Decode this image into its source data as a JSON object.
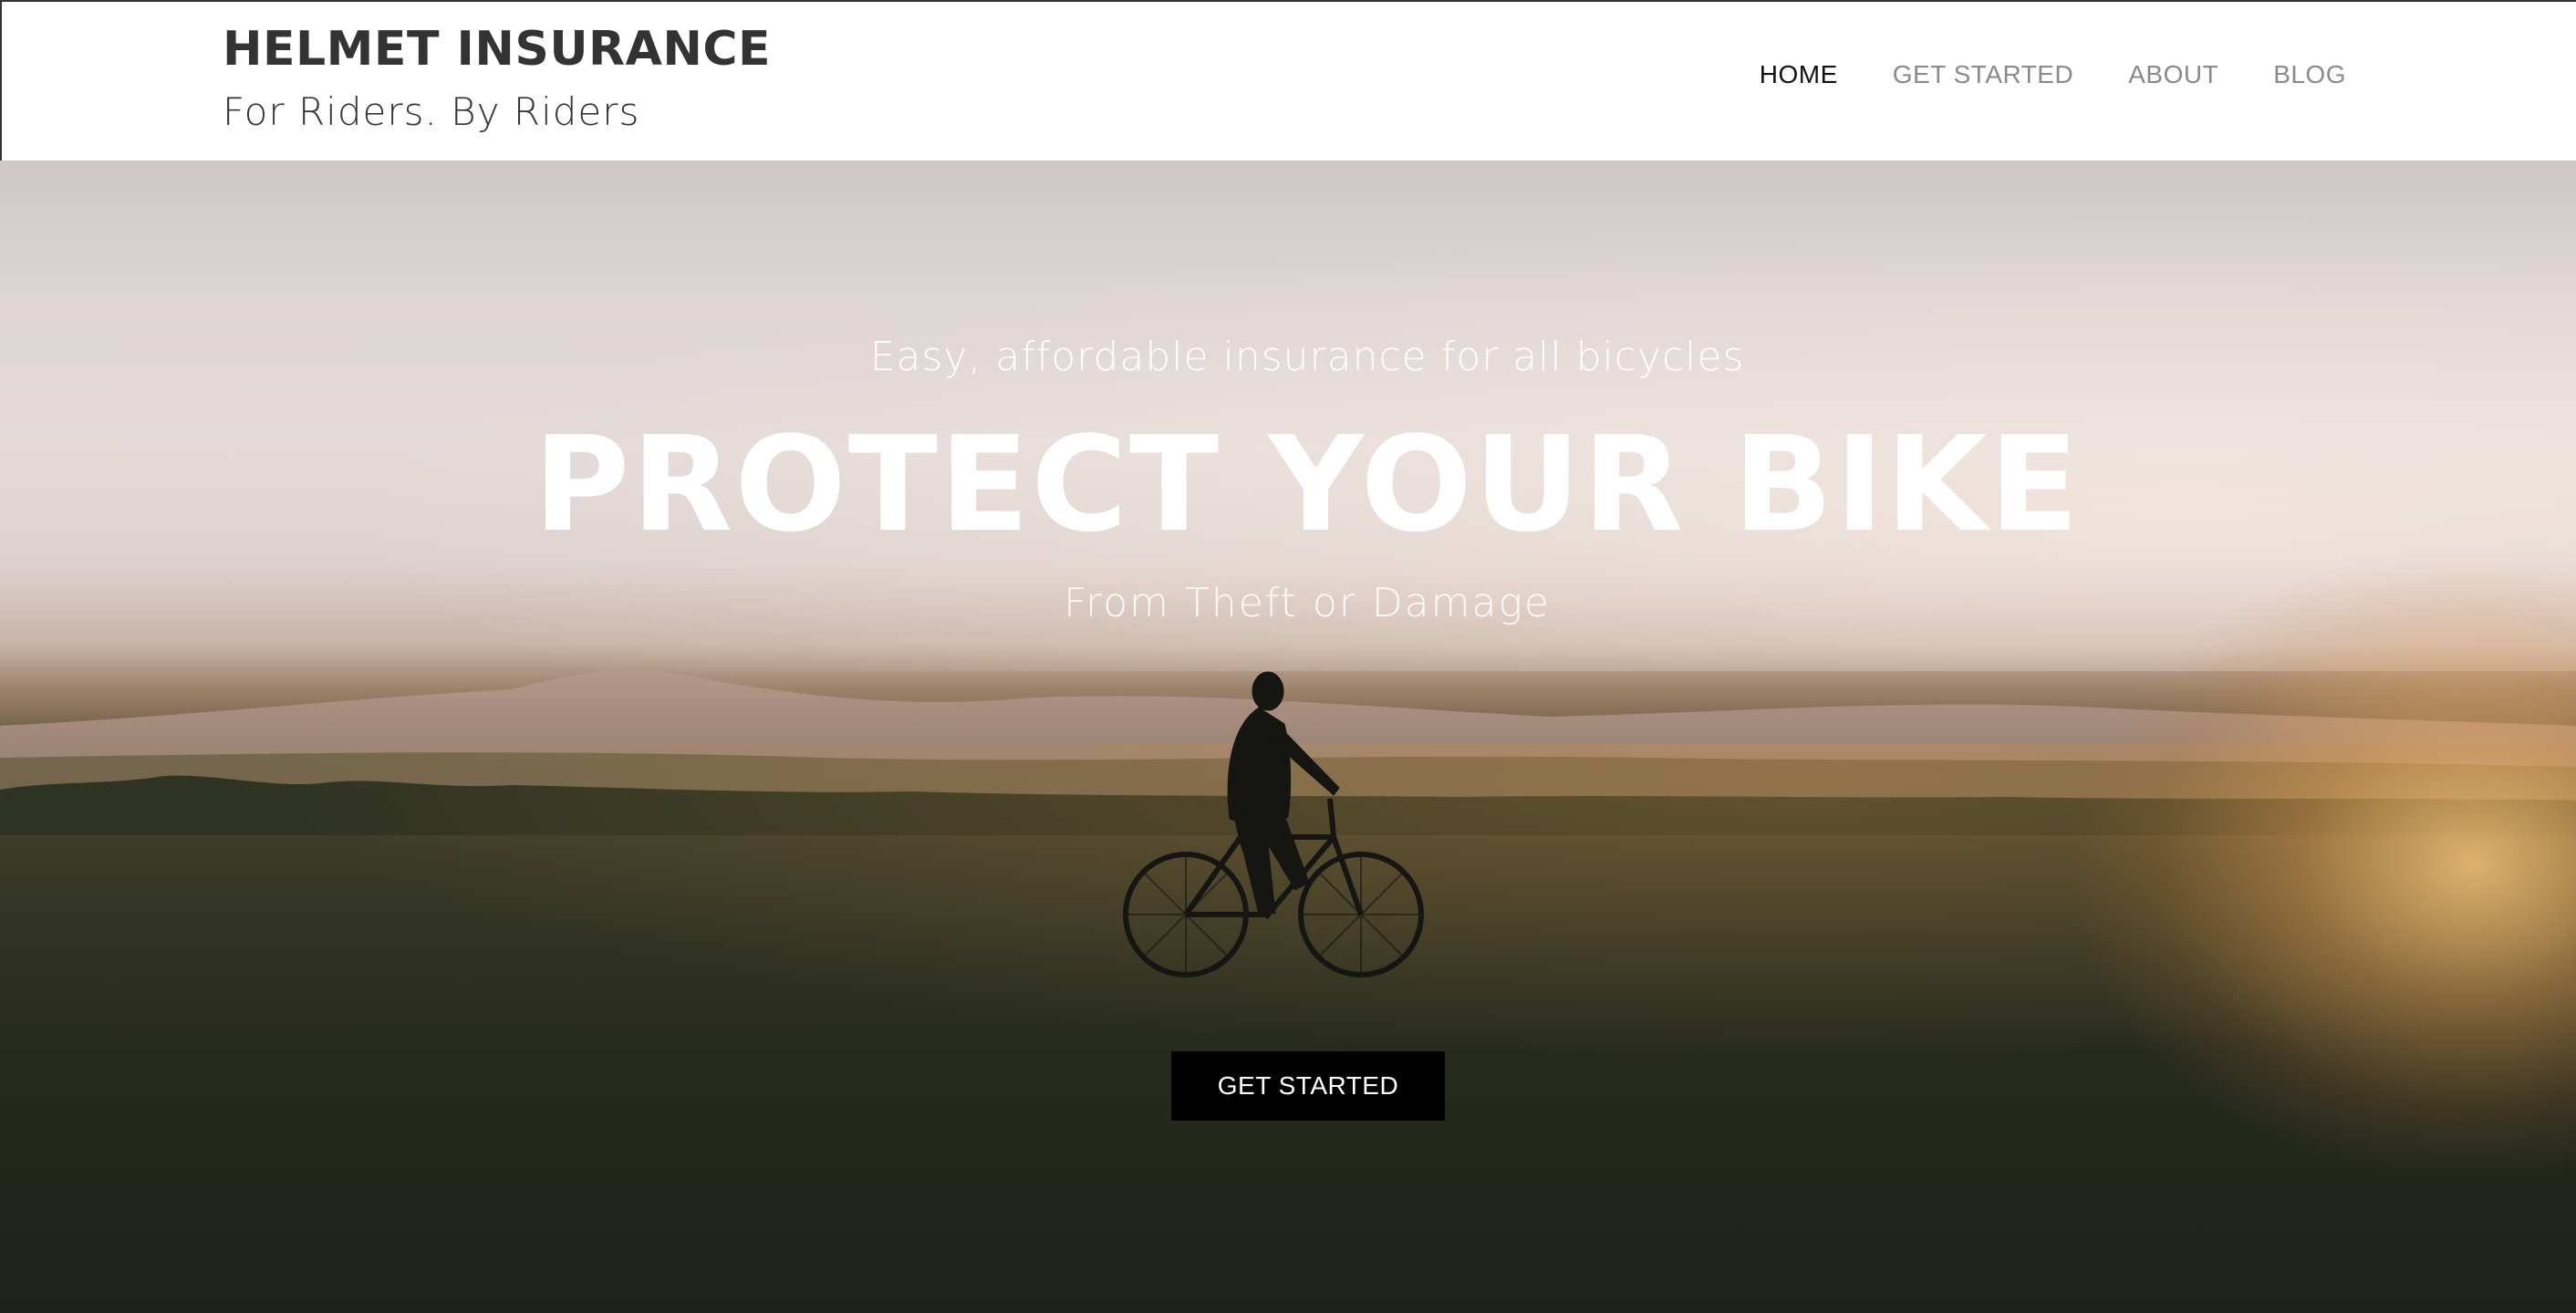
{
  "header": {
    "brand_title": "HELMET INSURANCE",
    "brand_tagline": "For Riders. By Riders",
    "nav": [
      {
        "label": "HOME",
        "active": true
      },
      {
        "label": "GET STARTED",
        "active": false
      },
      {
        "label": "ABOUT",
        "active": false
      },
      {
        "label": "BLOG",
        "active": false
      }
    ]
  },
  "hero": {
    "subtitle": "Easy, affordable insurance for all bicycles",
    "title": "PROTECT YOUR BIKE",
    "tagline": "From Theft or Damage",
    "cta_label": "GET STARTED",
    "background_image": "cyclist-at-sunset-photo"
  },
  "colors": {
    "header_bg": "#ffffff",
    "brand_text": "#333333",
    "nav_active": "#111111",
    "nav_inactive": "#8a8a8a",
    "cta_bg": "#000000",
    "cta_text": "#ffffff",
    "hero_text": "#ffffff"
  }
}
